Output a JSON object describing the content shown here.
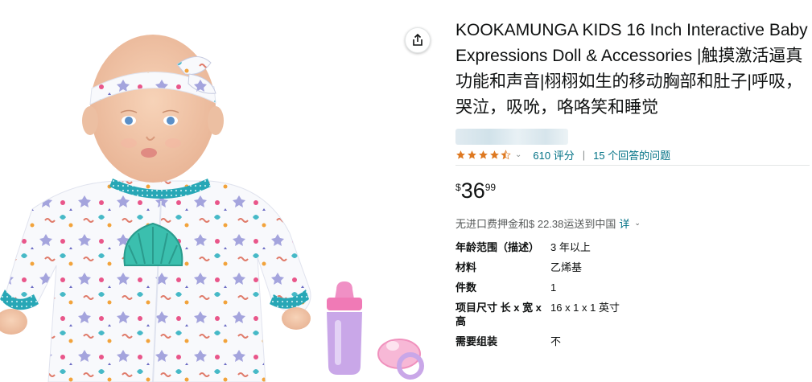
{
  "product": {
    "title": "KOOKAMUNGA KIDS 16 Inch Interactive Baby Expressions Doll & Accessories |触摸激活逼真功能和声音|栩栩如生的移动胸部和肚子|呼吸，哭泣，吸吮，咯咯笑和睡觉",
    "image_alt": "baby-doll-with-bottle-and-pacifier"
  },
  "rating": {
    "stars": 4.5,
    "count_label": "610 评分",
    "qa_label": "15 个回答的问题"
  },
  "price": {
    "symbol": "$",
    "whole": "36",
    "fraction": "99"
  },
  "shipping": {
    "text": "无进口费押金和$ 22.38运送到中国",
    "detail_link": "详"
  },
  "specs": [
    {
      "key": "年龄范围（描述）",
      "value": "3 年以上"
    },
    {
      "key": "材料",
      "value": "乙烯基"
    },
    {
      "key": "件数",
      "value": "1"
    },
    {
      "key": "项目尺寸 长 x 宽 x 高",
      "value": "16 x 1 x 1 英寸"
    },
    {
      "key": "需要组装",
      "value": "不"
    }
  ],
  "colors": {
    "star": "#de7921",
    "link": "#007185",
    "text": "#0f1111",
    "muted": "#565959"
  }
}
